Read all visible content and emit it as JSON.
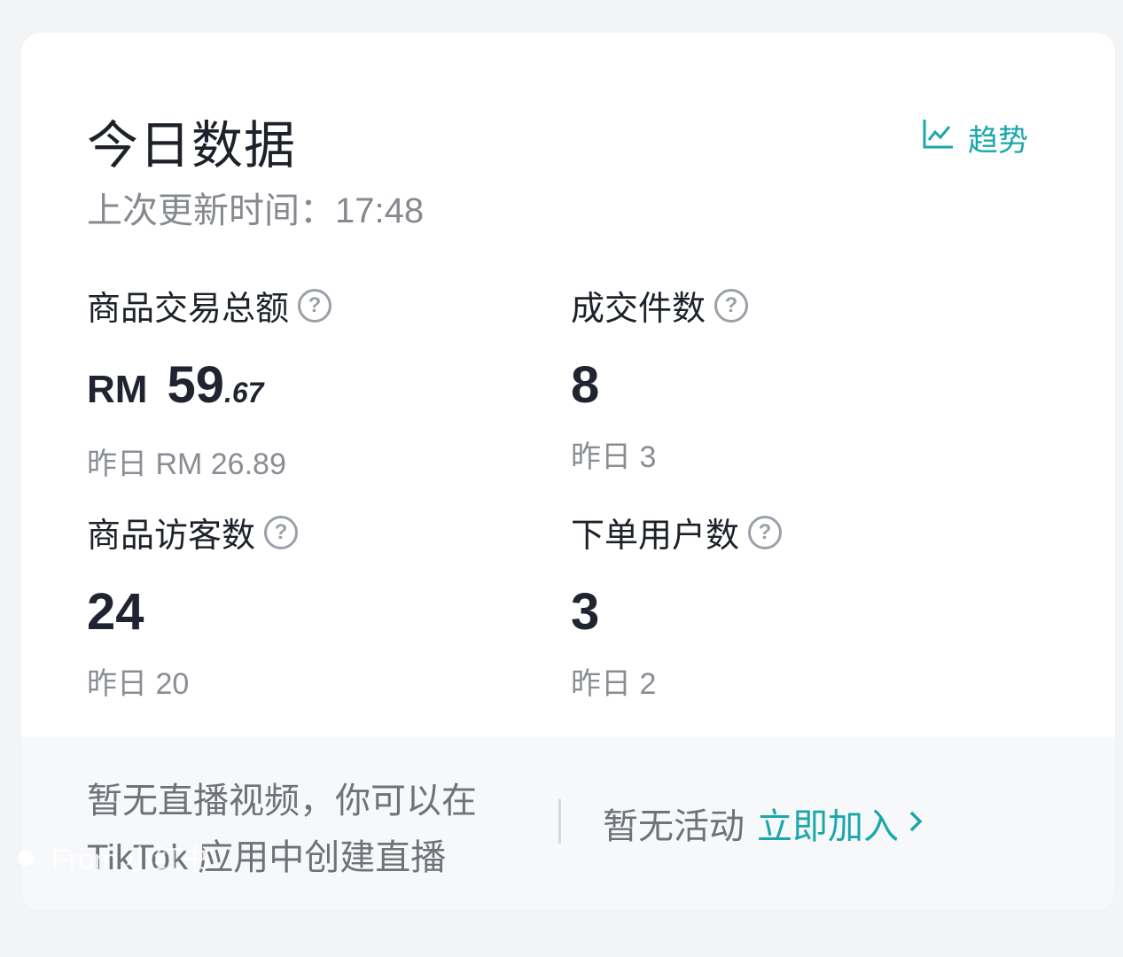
{
  "header": {
    "title": "今日数据",
    "updated_label": "上次更新时间：17:48",
    "trend_label": "趋势",
    "trend_icon": "line-chart-icon",
    "accent_color": "#1aa7ab"
  },
  "metrics": {
    "gmv": {
      "label": "商品交易总额",
      "currency": "RM",
      "value_int": "59",
      "value_dec": ".67",
      "prev": "昨日 RM 26.89"
    },
    "orders": {
      "label": "成交件数",
      "value": "8",
      "prev": "昨日 3"
    },
    "visitors": {
      "label": "商品访客数",
      "value": "24",
      "prev": "昨日 20"
    },
    "buyers": {
      "label": "下单用户数",
      "value": "3",
      "prev": "昨日 2"
    },
    "help_icon": "question-circle-icon"
  },
  "bottom": {
    "empty_live": "暂无直播视频，你可以在 TikTok 应用中创建直播",
    "no_activity": "暂无活动",
    "join_label": "立即加入",
    "join_icon": "chevron-right-icon"
  },
  "watermark": {
    "text": "From 小红书"
  }
}
